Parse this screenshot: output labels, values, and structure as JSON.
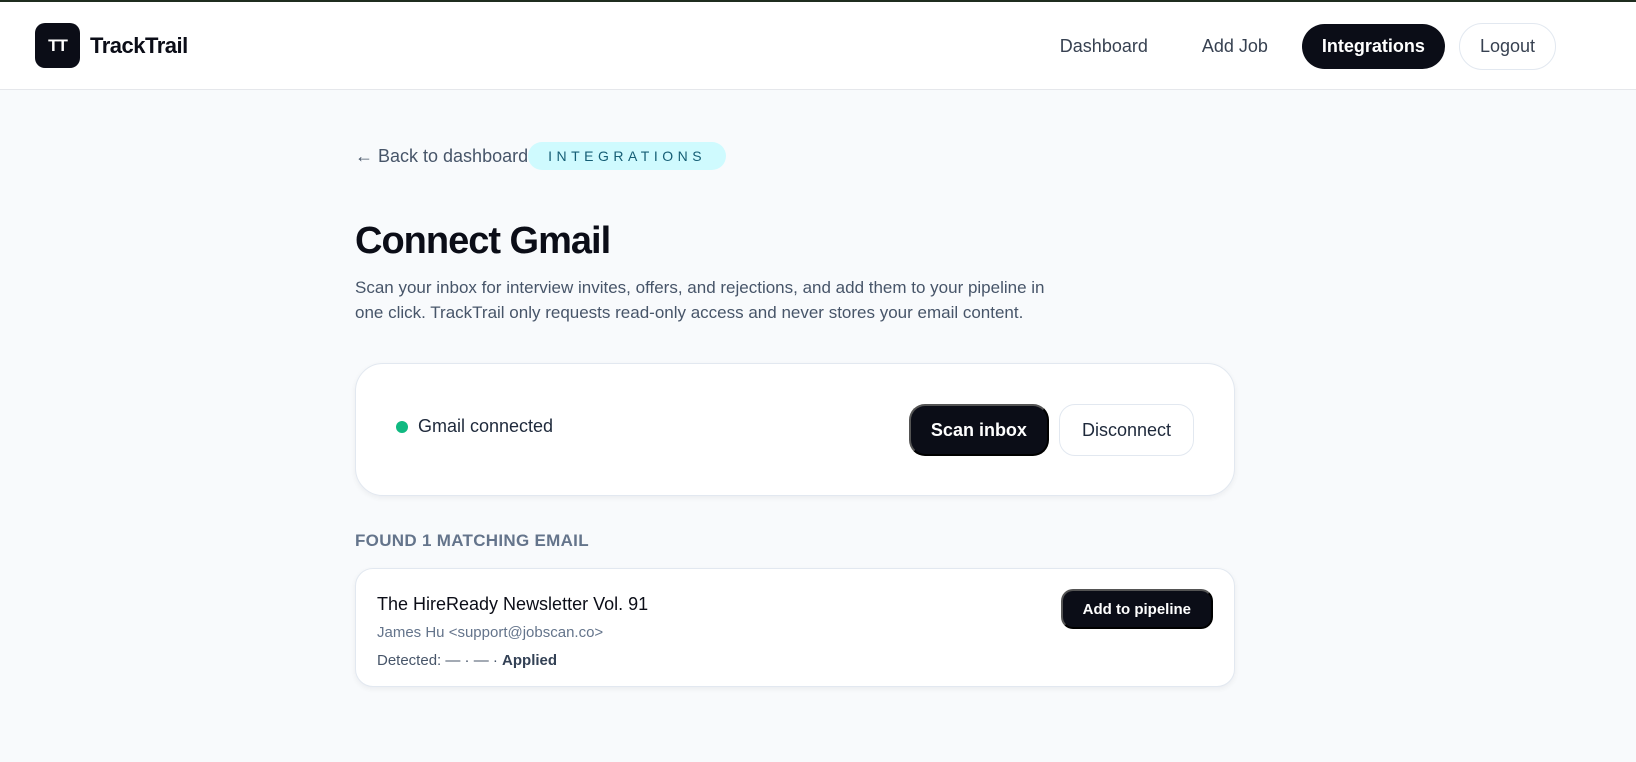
{
  "app": {
    "logo_mark": "TT",
    "name": "TrackTrail"
  },
  "nav": {
    "items": [
      {
        "label": "Dashboard"
      },
      {
        "label": "Add Job"
      },
      {
        "label": "Integrations",
        "active": true
      },
      {
        "label": "Logout"
      }
    ]
  },
  "breadcrumb": {
    "back_label": "← Back to dashboard",
    "section_pill": "INTEGRATIONS"
  },
  "page": {
    "title": "Connect Gmail",
    "description": "Scan your inbox for interview invites, offers, and rejections, and add them to your pipeline in one click. TrackTrail only requests read-only access and never stores your email content."
  },
  "connection": {
    "status_text": "Gmail connected",
    "status_color": "#10b981",
    "scan_label": "Scan inbox",
    "disconnect_label": "Disconnect"
  },
  "results": {
    "label": "FOUND 1 MATCHING EMAIL",
    "emails": [
      {
        "subject": "The HireReady Newsletter Vol. 91",
        "from": "James Hu <support@jobscan.co>",
        "detected_prefix": "Detected: — · — · ",
        "detected_status": "Applied",
        "action_label": "Add to pipeline"
      }
    ]
  },
  "colors": {
    "primary": "#0b0d17",
    "pill_bg": "#cffafe",
    "page_bg": "#f8fafc"
  }
}
